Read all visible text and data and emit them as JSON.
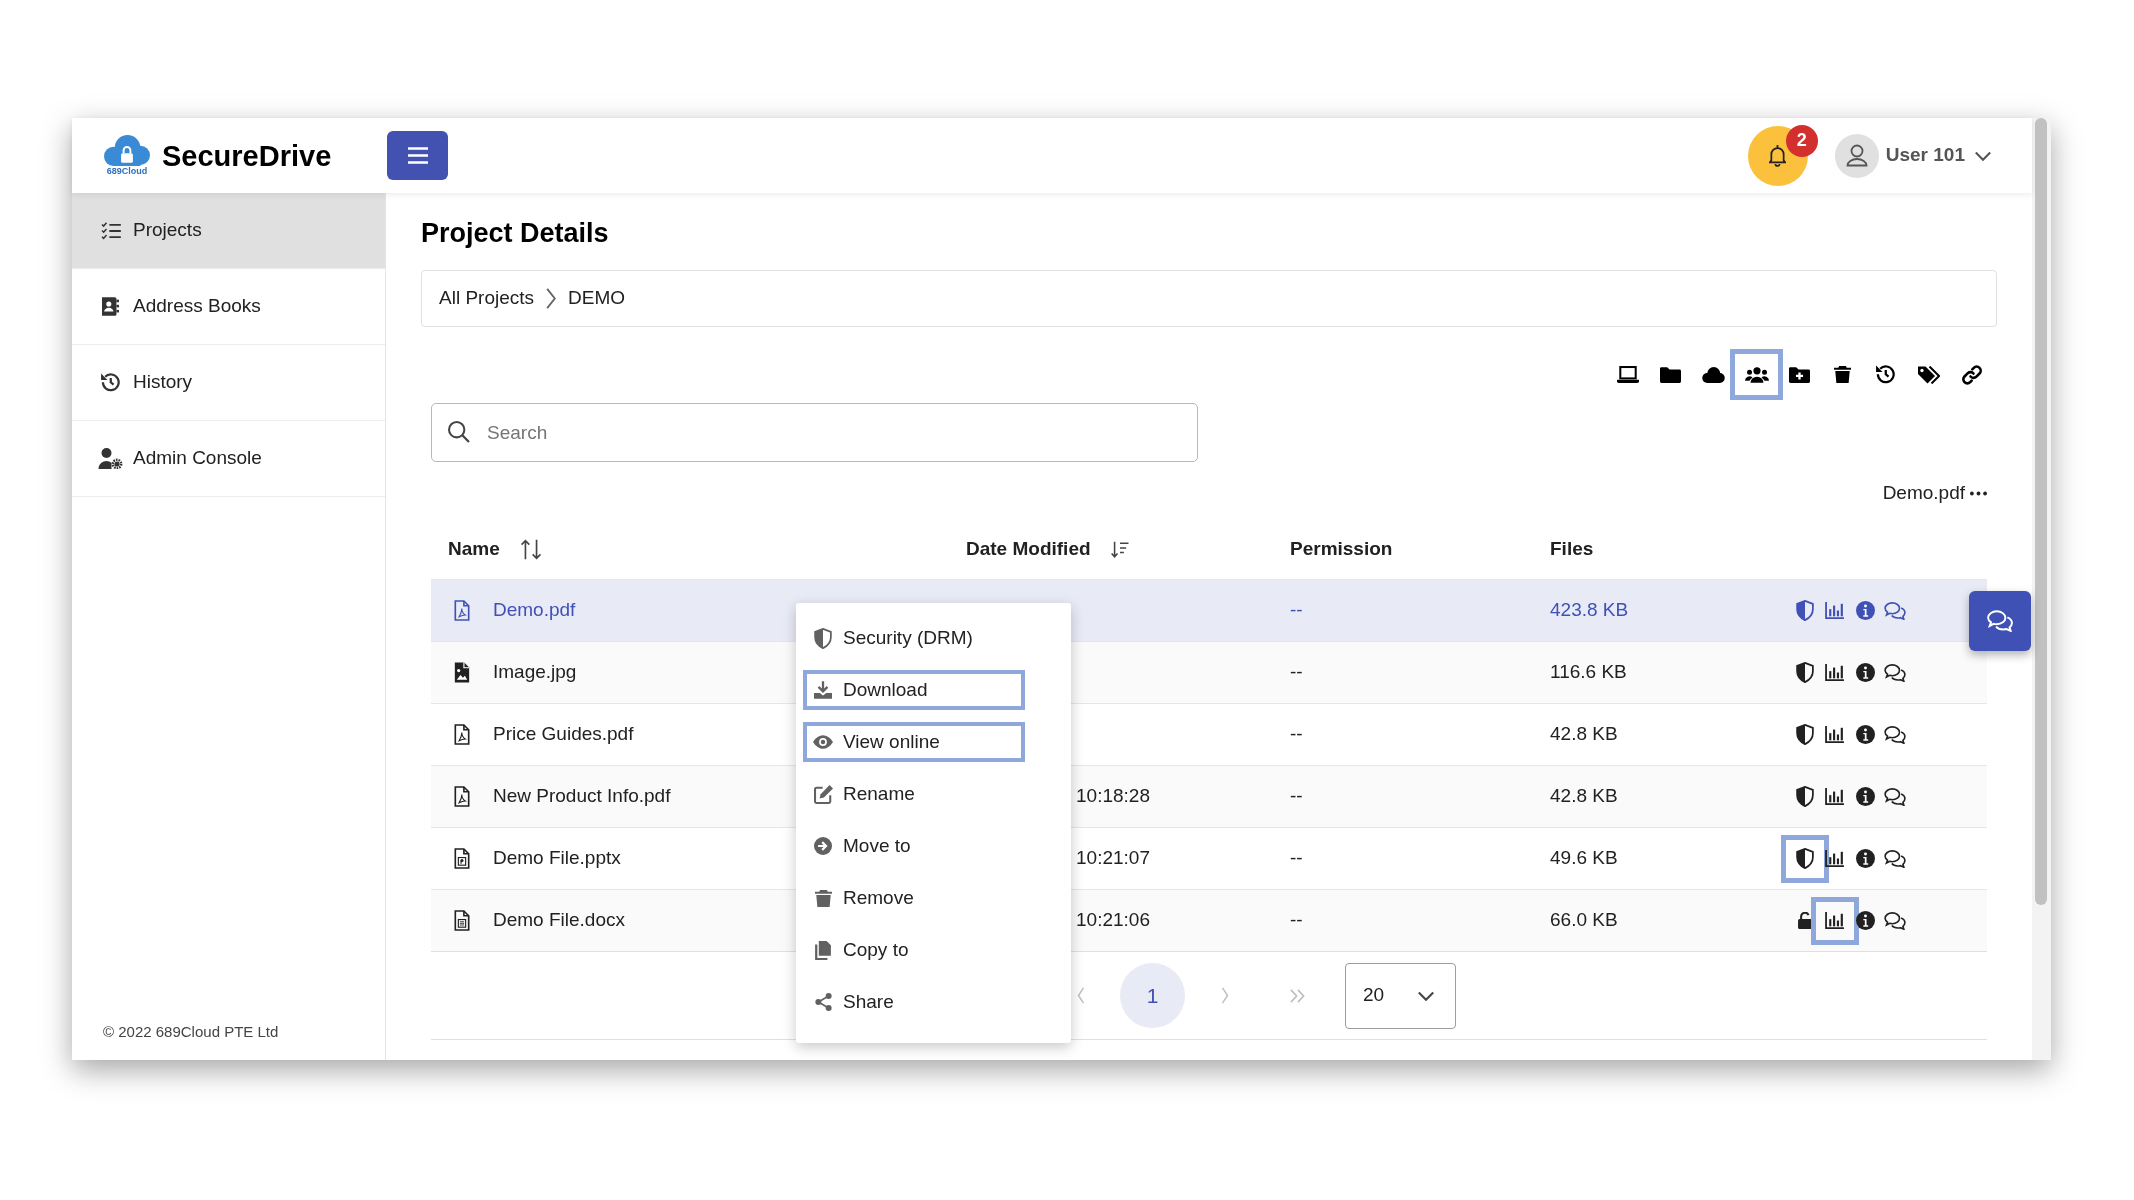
{
  "header": {
    "logo_text": "689Cloud",
    "app_name": "SecureDrive",
    "notification_count": "2",
    "user_name": "User 101"
  },
  "sidebar": {
    "items": [
      {
        "kind": "projects",
        "label": "Projects",
        "selected": true
      },
      {
        "kind": "address_books",
        "label": "Address Books",
        "selected": false
      },
      {
        "kind": "history",
        "label": "History",
        "selected": false
      },
      {
        "kind": "admin",
        "label": "Admin Console",
        "selected": false
      }
    ],
    "copyright": "© 2022 689Cloud PTE Ltd"
  },
  "page_title": "Project Details",
  "breadcrumb": [
    "All Projects",
    "DEMO"
  ],
  "toolbar": [
    {
      "kind": "laptop",
      "highlighted": false
    },
    {
      "kind": "folder",
      "highlighted": false
    },
    {
      "kind": "cloud",
      "highlighted": false
    },
    {
      "kind": "users",
      "highlighted": true
    },
    {
      "kind": "folder_plus",
      "highlighted": false
    },
    {
      "kind": "trash",
      "highlighted": false
    },
    {
      "kind": "history",
      "highlighted": false
    },
    {
      "kind": "tags",
      "highlighted": false
    },
    {
      "kind": "link",
      "highlighted": false
    }
  ],
  "search": {
    "placeholder": "Search"
  },
  "selected_file": "Demo.pdf",
  "table": {
    "columns": [
      {
        "label": "Name",
        "sortable": true,
        "sorted": false
      },
      {
        "label": "Date Modified",
        "sortable": true,
        "sorted": true
      },
      {
        "label": "Permission",
        "sortable": false
      },
      {
        "label": "Files",
        "sortable": false
      }
    ],
    "rows": [
      {
        "kind": "pdf",
        "name": "Demo.pdf",
        "permission": "--",
        "size": "423.8 KB",
        "selected": true,
        "actions": [
          {
            "kind": "shield",
            "highlighted": false
          },
          {
            "kind": "chart",
            "highlighted": false
          },
          {
            "kind": "info",
            "highlighted": false
          },
          {
            "kind": "comments",
            "highlighted": false
          }
        ]
      },
      {
        "kind": "image",
        "name": "Image.jpg",
        "permission": "--",
        "size": "116.6 KB",
        "selected": false,
        "actions": [
          {
            "kind": "shield",
            "highlighted": false
          },
          {
            "kind": "chart",
            "highlighted": false
          },
          {
            "kind": "info",
            "highlighted": false
          },
          {
            "kind": "comments",
            "highlighted": false
          }
        ]
      },
      {
        "kind": "pdf",
        "name": "Price Guides.pdf",
        "permission": "--",
        "size": "42.8 KB",
        "selected": false,
        "actions": [
          {
            "kind": "shield",
            "highlighted": false
          },
          {
            "kind": "chart",
            "highlighted": false
          },
          {
            "kind": "info",
            "highlighted": false
          },
          {
            "kind": "comments",
            "highlighted": false
          }
        ]
      },
      {
        "kind": "pdf",
        "name": "New Product Info.pdf",
        "date": "10:18:28",
        "permission": "--",
        "size": "42.8 KB",
        "selected": false,
        "actions": [
          {
            "kind": "shield",
            "highlighted": false
          },
          {
            "kind": "chart",
            "highlighted": false
          },
          {
            "kind": "info",
            "highlighted": false
          },
          {
            "kind": "comments",
            "highlighted": false
          }
        ]
      },
      {
        "kind": "pptx",
        "name": "Demo File.pptx",
        "date": "10:21:07",
        "permission": "--",
        "size": "49.6 KB",
        "selected": false,
        "actions": [
          {
            "kind": "shield",
            "highlighted": true
          },
          {
            "kind": "chart",
            "highlighted": false
          },
          {
            "kind": "info",
            "highlighted": false
          },
          {
            "kind": "comments",
            "highlighted": false
          }
        ]
      },
      {
        "kind": "docx",
        "name": "Demo File.docx",
        "date": "10:21:06",
        "permission": "--",
        "size": "66.0 KB",
        "selected": false,
        "actions": [
          {
            "kind": "lock",
            "highlighted": false
          },
          {
            "kind": "chart",
            "highlighted": true
          },
          {
            "kind": "info",
            "highlighted": false
          },
          {
            "kind": "comments",
            "highlighted": false
          }
        ]
      }
    ]
  },
  "context_menu": [
    {
      "kind": "security",
      "label": "Security (DRM)",
      "highlighted": false
    },
    {
      "kind": "download",
      "label": "Download",
      "highlighted": true
    },
    {
      "kind": "view",
      "label": "View online",
      "highlighted": true
    },
    {
      "kind": "rename",
      "label": "Rename",
      "highlighted": false
    },
    {
      "kind": "move",
      "label": "Move to",
      "highlighted": false
    },
    {
      "kind": "remove",
      "label": "Remove",
      "highlighted": false
    },
    {
      "kind": "copy",
      "label": "Copy to",
      "highlighted": false
    },
    {
      "kind": "share",
      "label": "Share",
      "highlighted": false
    }
  ],
  "pagination": {
    "pages": [
      {
        "label": "1",
        "selected": true
      }
    ],
    "page_size": "20"
  }
}
